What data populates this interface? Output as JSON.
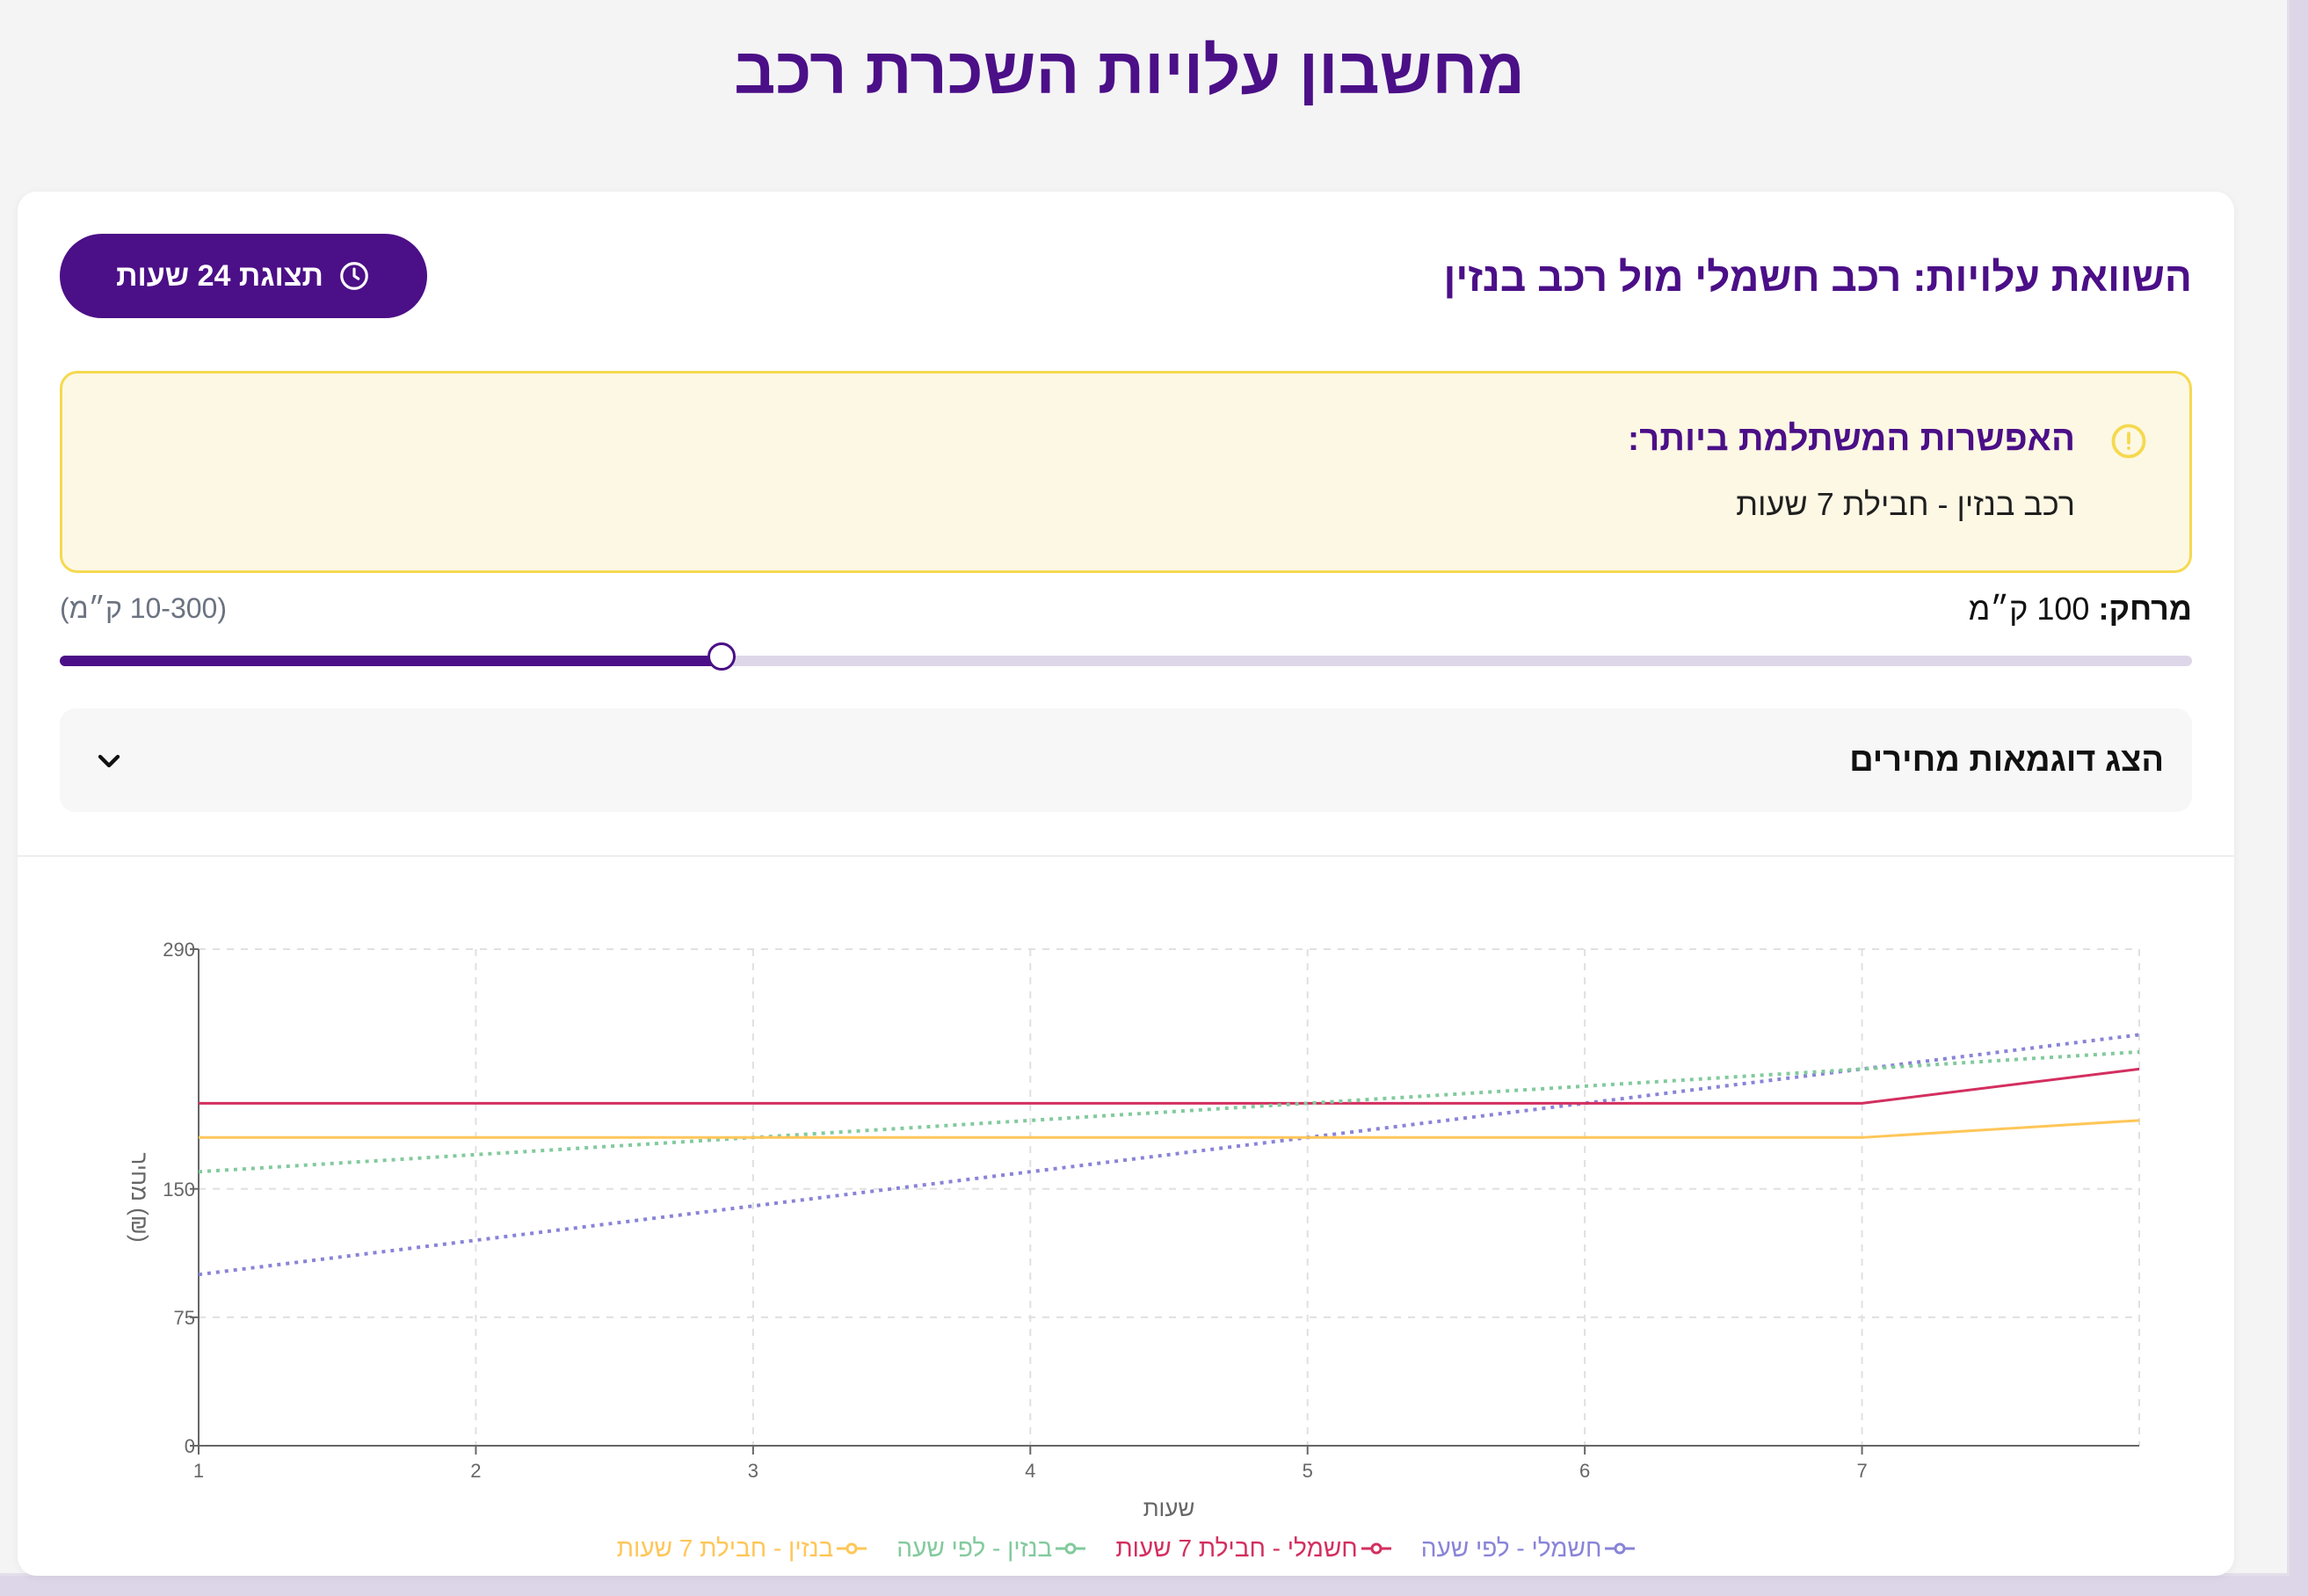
{
  "page": {
    "title": "מחשבון עלויות השכרת רכב"
  },
  "card": {
    "title": "השוואת עלויות: רכב חשמלי מול רכב בנזין",
    "view_button": {
      "label": "תצוגת 24 שעות",
      "icon": "clock-icon"
    }
  },
  "alert": {
    "icon": "exclamation-circle-icon",
    "title": "האפשרות המשתלמת ביותר:",
    "text": "רכב בנזין - חבילת 7 שעות",
    "colors": {
      "background": "#fdf8e4",
      "border": "#f5d94f",
      "icon": "#f5d94f"
    }
  },
  "distance": {
    "label": "מרחק:",
    "value_text": "100 ק״מ",
    "range_text": "(10-300 ק״מ)",
    "min": 10,
    "max": 300,
    "value": 100
  },
  "price_examples": {
    "label": "הצג דוגמאות מחירים",
    "icon": "chevron-down-icon"
  },
  "colors": {
    "accent": "#4b0f87",
    "electric_hourly": "#8884d8",
    "electric_package": "#d32f5f",
    "gas_hourly": "#82ca9d",
    "gas_package": "#ffc658"
  },
  "chart_data": {
    "type": "line",
    "xlabel": "שעות",
    "ylabel": "מחיר (₪)",
    "x": [
      1,
      2,
      3,
      4,
      5,
      6,
      7,
      8
    ],
    "xlim": [
      1,
      8
    ],
    "ylim": [
      0,
      290
    ],
    "xticks": [
      "1",
      "2",
      "3",
      "4",
      "5",
      "6",
      "7"
    ],
    "yticks": [
      "0",
      "75",
      "150",
      "290"
    ],
    "grid": true,
    "legend_position": "bottom",
    "series": [
      {
        "name": "חשמלי - לפי שעה",
        "values": [
          100,
          120,
          140,
          160,
          180,
          200,
          220,
          240
        ],
        "style": "dotted",
        "color": "#8884d8"
      },
      {
        "name": "חשמלי - חבילת 7 שעות",
        "values": [
          200,
          200,
          200,
          200,
          200,
          200,
          200,
          220
        ],
        "style": "solid",
        "color": "#d32f5f"
      },
      {
        "name": "בנזין - לפי שעה",
        "values": [
          160,
          170,
          180,
          190,
          200,
          210,
          220,
          230
        ],
        "style": "dotted",
        "color": "#82ca9d"
      },
      {
        "name": "בנזין - חבילת 7 שעות",
        "values": [
          180,
          180,
          180,
          180,
          180,
          180,
          180,
          190
        ],
        "style": "solid",
        "color": "#ffc658"
      }
    ]
  }
}
